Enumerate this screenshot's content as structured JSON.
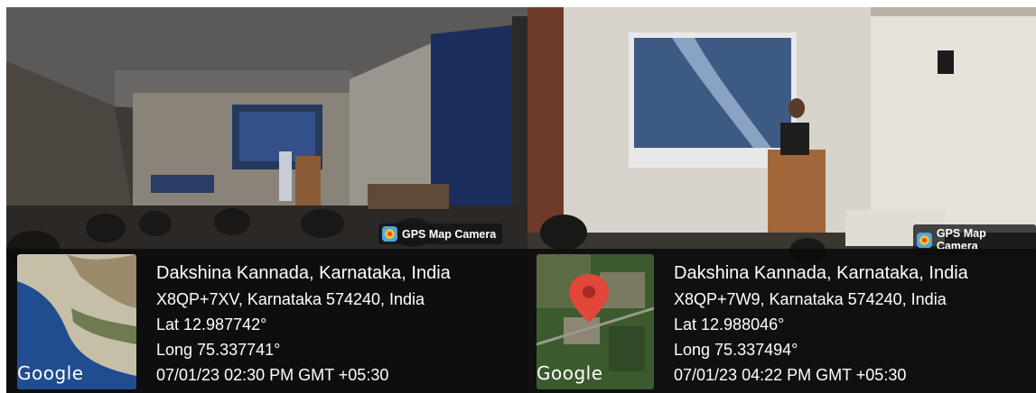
{
  "photos": [
    {
      "badge": "GPS Map Camera",
      "google_label": "Google",
      "place": "Dakshina Kannada, Karnataka, India",
      "address": "X8QP+7XV, Karnataka 574240, India",
      "lat": "Lat 12.987742°",
      "long": "Long 75.337741°",
      "timestamp": "07/01/23 02:30 PM GMT +05:30"
    },
    {
      "badge": "GPS Map Camera",
      "google_label": "Google",
      "place": "Dakshina Kannada, Karnataka, India",
      "address": "X8QP+7W9, Karnataka 574240, India",
      "lat": "Lat 12.988046°",
      "long": "Long 75.337494°",
      "timestamp": "07/01/23 04:22 PM GMT +05:30"
    }
  ],
  "icons": {
    "app_logo": "gps-map-camera-icon",
    "map_pin": "map-pin-icon"
  },
  "colors": {
    "overlay": "#0a0a0a",
    "text": "#ffffff",
    "pin": "#e0463a"
  }
}
